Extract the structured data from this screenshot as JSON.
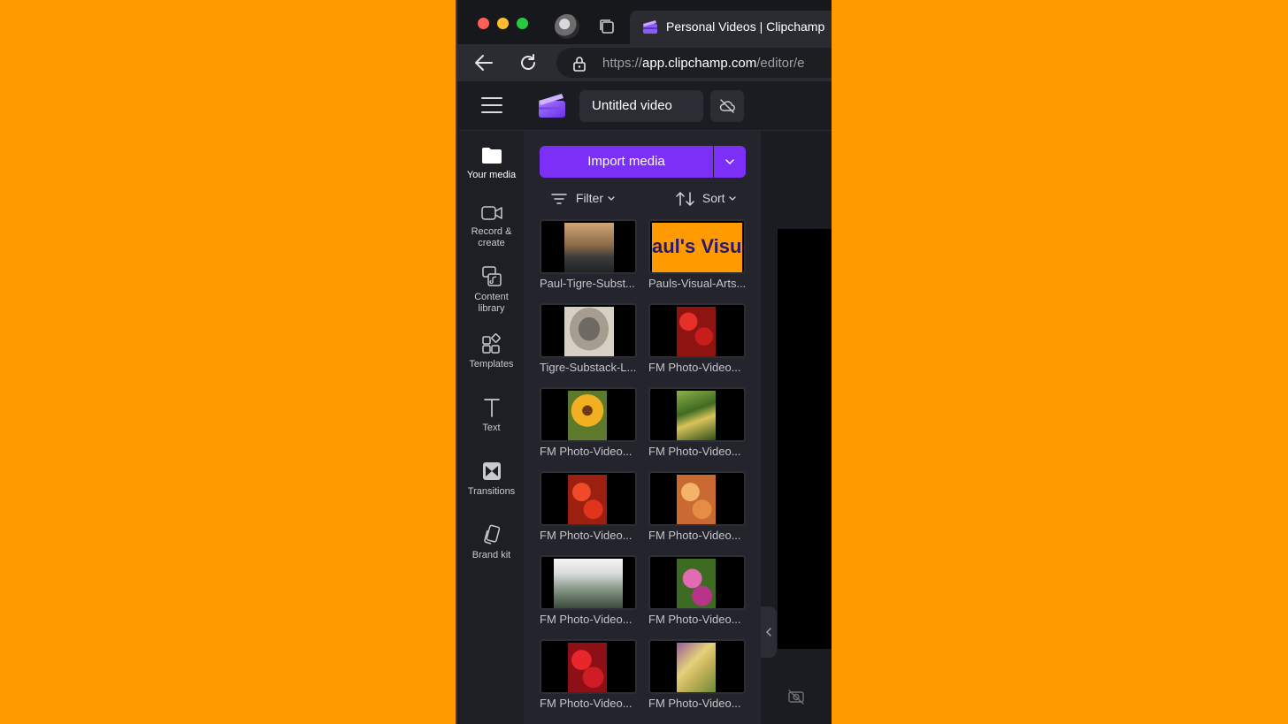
{
  "browser": {
    "tab_title": "Personal Videos | Clipchamp",
    "url_scheme": "https://",
    "url_host": "app.clipchamp.com",
    "url_path": "/editor/e"
  },
  "app": {
    "video_title": "Untitled video"
  },
  "nav": {
    "items": [
      {
        "label": "Your media",
        "icon": "folder-icon",
        "active": true
      },
      {
        "label": "Record &\ncreate",
        "icon": "camera-icon"
      },
      {
        "label": "Content\nlibrary",
        "icon": "content-library-icon"
      },
      {
        "label": "Templates",
        "icon": "templates-icon"
      },
      {
        "label": "Text",
        "icon": "text-icon"
      },
      {
        "label": "Transitions",
        "icon": "transitions-icon"
      },
      {
        "label": "Brand kit",
        "icon": "brand-kit-icon"
      }
    ]
  },
  "media": {
    "import_label": "Import media",
    "filter_label": "Filter",
    "sort_label": "Sort",
    "items": [
      {
        "name": "Paul-Tigre-Subst...",
        "thumb": "portrait-man-cat",
        "color": "#b08a5a"
      },
      {
        "name": "Pauls-Visual-Arts...",
        "thumb": "title-card",
        "thumb_text": "aul's Visu",
        "color": "#FF9A00"
      },
      {
        "name": "Tigre-Substack-L...",
        "thumb": "cat",
        "color": "#8a8478"
      },
      {
        "name": "FM Photo-Video...",
        "thumb": "strawberries",
        "color": "#c0201e"
      },
      {
        "name": "FM Photo-Video...",
        "thumb": "sunflower",
        "color": "#e3a21a"
      },
      {
        "name": "FM Photo-Video...",
        "thumb": "zucchini",
        "color": "#4f7d2a"
      },
      {
        "name": "FM Photo-Video...",
        "thumb": "tomatoes",
        "color": "#d8351c"
      },
      {
        "name": "FM Photo-Video...",
        "thumb": "peaches",
        "color": "#e59a52"
      },
      {
        "name": "FM Photo-Video...",
        "thumb": "market-tent",
        "color": "#9aa3a0"
      },
      {
        "name": "FM Photo-Video...",
        "thumb": "radishes",
        "color": "#b83a8e"
      },
      {
        "name": "FM Photo-Video...",
        "thumb": "peppers",
        "color": "#d01c24"
      },
      {
        "name": "FM Photo-Video...",
        "thumb": "squash",
        "color": "#c7b35a"
      }
    ]
  }
}
